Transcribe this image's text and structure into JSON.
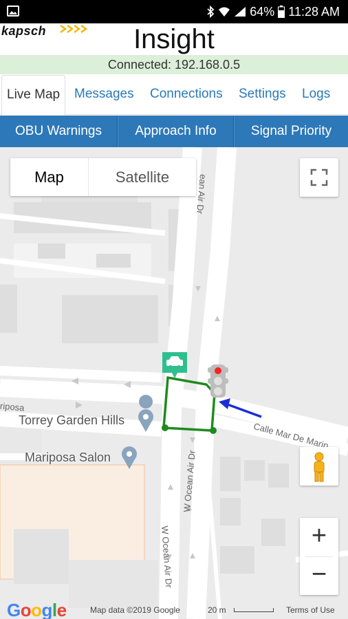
{
  "status_bar": {
    "battery": "64%",
    "time": "11:28 AM"
  },
  "header": {
    "logo": "kapsch",
    "title": "Insight"
  },
  "connection": {
    "status": "Connected: 192.168.0.5"
  },
  "tabs": [
    {
      "label": "Live Map",
      "active": true
    },
    {
      "label": "Messages",
      "active": false
    },
    {
      "label": "Connections",
      "active": false
    },
    {
      "label": "Settings",
      "active": false
    },
    {
      "label": "Logs",
      "active": false
    }
  ],
  "subnav": [
    {
      "label": "OBU Warnings"
    },
    {
      "label": "Approach Info"
    },
    {
      "label": "Signal Priority"
    }
  ],
  "map": {
    "map_type": {
      "map": "Map",
      "satellite": "Satellite"
    },
    "places": [
      {
        "name": "Torrey Garden Hills"
      },
      {
        "name": "Mariposa Salon"
      }
    ],
    "streets": {
      "ocean_air_top": "ean Air Dr",
      "ocean_air_mid": "W Ocean Air Dr",
      "ocean_air_bottom": "W Ocean Air Dr",
      "mariposa": "riposa",
      "calle": "Calle Mar De Marip"
    },
    "zoom_in": "+",
    "zoom_out": "−",
    "google_logo": "Google",
    "attribution": "Map data ©2019 Google",
    "scale": "20 m",
    "terms": "Terms of Use",
    "colors": {
      "intersection_outline": "#1f8a1f",
      "approach_arrow": "#1a2fd6",
      "vehicle_marker": "#2fbf8f",
      "signal_red": "#ff2020"
    }
  }
}
